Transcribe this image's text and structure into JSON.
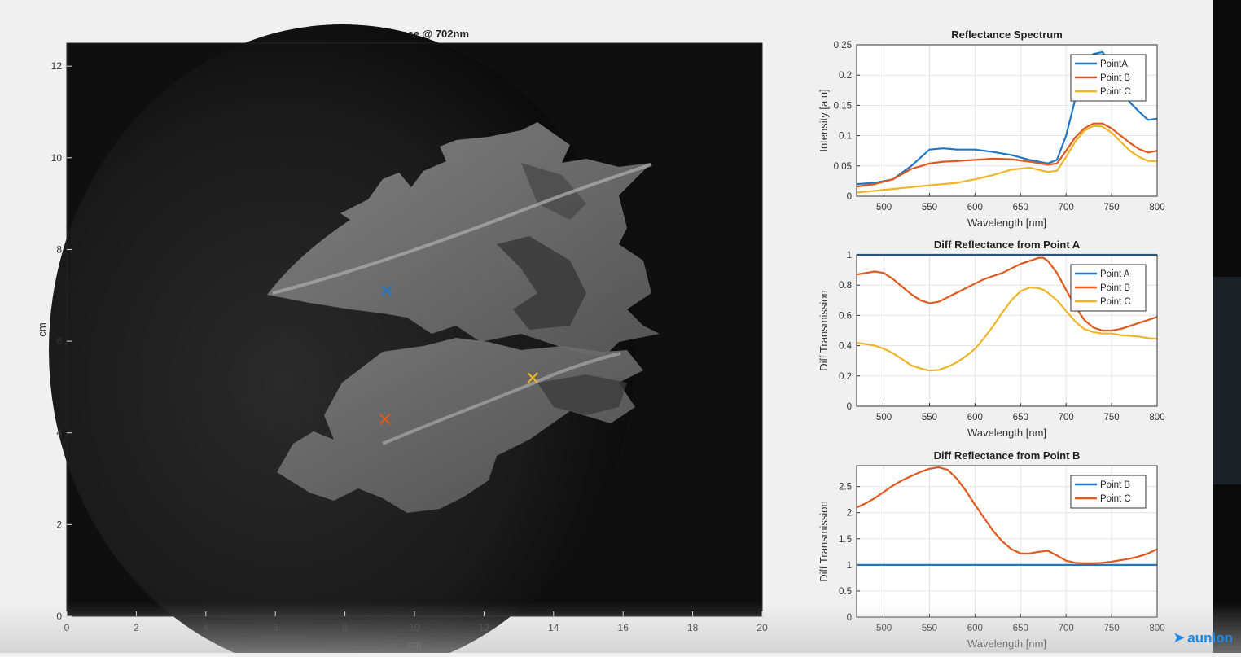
{
  "image_panel": {
    "title": "Reflectance @ 702nm",
    "xlabel": "cm",
    "ylabel": "cm",
    "xlim": [
      0,
      20
    ],
    "ylim": [
      0,
      12.5
    ],
    "xticks": [
      "0",
      "2",
      "4",
      "6",
      "8",
      "10",
      "12",
      "14",
      "16",
      "18",
      "20"
    ],
    "yticks": [
      "0",
      "2",
      "4",
      "6",
      "8",
      "10",
      "12"
    ],
    "markers": [
      {
        "name": "Point A",
        "x": 9.2,
        "y": 7.1,
        "color": "#1f77c8"
      },
      {
        "name": "Point B",
        "x": 9.15,
        "y": 4.3,
        "color": "#e0581b"
      },
      {
        "name": "Point C",
        "x": 13.4,
        "y": 5.2,
        "color": "#f0b428"
      }
    ]
  },
  "chart_data": [
    {
      "type": "line",
      "title": "Reflectance Spectrum",
      "xlabel": "Wavelength [nm]",
      "ylabel": "Intensity [a.u]",
      "xlim": [
        470,
        800
      ],
      "ylim": [
        0,
        0.25
      ],
      "xticks": [
        "500",
        "550",
        "600",
        "650",
        "700",
        "750",
        "800"
      ],
      "yticks": [
        "0",
        "0.05",
        "0.1",
        "0.15",
        "0.2",
        "0.25"
      ],
      "grid": true,
      "legend": "top-right",
      "x": [
        470,
        490,
        510,
        530,
        550,
        565,
        580,
        600,
        620,
        640,
        660,
        680,
        690,
        700,
        710,
        720,
        730,
        740,
        750,
        760,
        770,
        780,
        790,
        800
      ],
      "series": [
        {
          "name": "PointA",
          "color": "#1f77c8",
          "values": [
            0.02,
            0.022,
            0.028,
            0.05,
            0.077,
            0.079,
            0.077,
            0.077,
            0.073,
            0.068,
            0.06,
            0.054,
            0.06,
            0.1,
            0.16,
            0.21,
            0.235,
            0.238,
            0.215,
            0.185,
            0.155,
            0.14,
            0.126,
            0.128
          ]
        },
        {
          "name": "Point B",
          "color": "#e0581b",
          "values": [
            0.016,
            0.02,
            0.028,
            0.045,
            0.054,
            0.057,
            0.058,
            0.06,
            0.062,
            0.061,
            0.057,
            0.052,
            0.054,
            0.075,
            0.097,
            0.112,
            0.12,
            0.12,
            0.112,
            0.1,
            0.088,
            0.078,
            0.072,
            0.075
          ]
        },
        {
          "name": "Point C",
          "color": "#f0b428",
          "values": [
            0.006,
            0.009,
            0.012,
            0.015,
            0.018,
            0.02,
            0.022,
            0.028,
            0.035,
            0.044,
            0.047,
            0.04,
            0.042,
            0.065,
            0.09,
            0.108,
            0.116,
            0.115,
            0.105,
            0.09,
            0.075,
            0.065,
            0.058,
            0.058
          ]
        }
      ]
    },
    {
      "type": "line",
      "title": "Diff Reflectance from Point A",
      "xlabel": "Wavelength [nm]",
      "ylabel": "Diff Transmission",
      "xlim": [
        470,
        800
      ],
      "ylim": [
        0,
        1
      ],
      "xticks": [
        "500",
        "550",
        "600",
        "650",
        "700",
        "750",
        "800"
      ],
      "yticks": [
        "0",
        "0.2",
        "0.4",
        "0.6",
        "0.8",
        "1"
      ],
      "grid": true,
      "legend": "top-right",
      "x": [
        470,
        480,
        490,
        500,
        510,
        520,
        530,
        540,
        550,
        560,
        570,
        580,
        590,
        600,
        610,
        620,
        630,
        640,
        650,
        660,
        670,
        675,
        680,
        690,
        700,
        710,
        720,
        730,
        740,
        750,
        760,
        770,
        780,
        790,
        800
      ],
      "series": [
        {
          "name": "Point A",
          "color": "#1f77c8",
          "values": [
            1,
            1,
            1,
            1,
            1,
            1,
            1,
            1,
            1,
            1,
            1,
            1,
            1,
            1,
            1,
            1,
            1,
            1,
            1,
            1,
            1,
            1,
            1,
            1,
            1,
            1,
            1,
            1,
            1,
            1,
            1,
            1,
            1,
            1,
            1
          ]
        },
        {
          "name": "Point B",
          "color": "#e0581b",
          "values": [
            0.87,
            0.88,
            0.89,
            0.88,
            0.84,
            0.79,
            0.74,
            0.7,
            0.68,
            0.69,
            0.72,
            0.75,
            0.78,
            0.81,
            0.84,
            0.86,
            0.88,
            0.91,
            0.94,
            0.96,
            0.98,
            0.98,
            0.96,
            0.88,
            0.77,
            0.66,
            0.57,
            0.52,
            0.5,
            0.5,
            0.51,
            0.53,
            0.55,
            0.57,
            0.59
          ]
        },
        {
          "name": "Point C",
          "color": "#f0b428",
          "values": [
            0.42,
            0.41,
            0.4,
            0.38,
            0.35,
            0.31,
            0.27,
            0.25,
            0.235,
            0.24,
            0.26,
            0.29,
            0.33,
            0.38,
            0.45,
            0.53,
            0.62,
            0.7,
            0.76,
            0.785,
            0.78,
            0.77,
            0.75,
            0.7,
            0.63,
            0.56,
            0.51,
            0.49,
            0.48,
            0.48,
            0.47,
            0.465,
            0.46,
            0.45,
            0.445
          ]
        }
      ]
    },
    {
      "type": "line",
      "title": "Diff Reflectance from Point B",
      "xlabel": "Wavelength [nm]",
      "ylabel": "Diff Transmission",
      "xlim": [
        470,
        800
      ],
      "ylim": [
        0,
        2.9
      ],
      "xticks": [
        "500",
        "550",
        "600",
        "650",
        "700",
        "750",
        "800"
      ],
      "yticks": [
        "0",
        "0.5",
        "1",
        "1.5",
        "2",
        "2.5"
      ],
      "grid": true,
      "legend": "top-right",
      "x": [
        470,
        480,
        490,
        500,
        510,
        520,
        530,
        540,
        550,
        560,
        570,
        580,
        590,
        600,
        610,
        620,
        630,
        640,
        650,
        660,
        670,
        680,
        690,
        700,
        710,
        720,
        730,
        740,
        750,
        760,
        770,
        780,
        790,
        800
      ],
      "series": [
        {
          "name": "Point B",
          "color": "#1f77c8",
          "values": [
            1,
            1,
            1,
            1,
            1,
            1,
            1,
            1,
            1,
            1,
            1,
            1,
            1,
            1,
            1,
            1,
            1,
            1,
            1,
            1,
            1,
            1,
            1,
            1,
            1,
            1,
            1,
            1,
            1,
            1,
            1,
            1,
            1,
            1
          ]
        },
        {
          "name": "Point C",
          "color": "#e0581b",
          "values": [
            2.1,
            2.18,
            2.28,
            2.4,
            2.52,
            2.62,
            2.7,
            2.78,
            2.84,
            2.87,
            2.82,
            2.65,
            2.42,
            2.15,
            1.9,
            1.65,
            1.45,
            1.3,
            1.22,
            1.22,
            1.25,
            1.27,
            1.18,
            1.08,
            1.04,
            1.03,
            1.03,
            1.04,
            1.06,
            1.09,
            1.12,
            1.16,
            1.22,
            1.3
          ]
        }
      ]
    }
  ]
}
